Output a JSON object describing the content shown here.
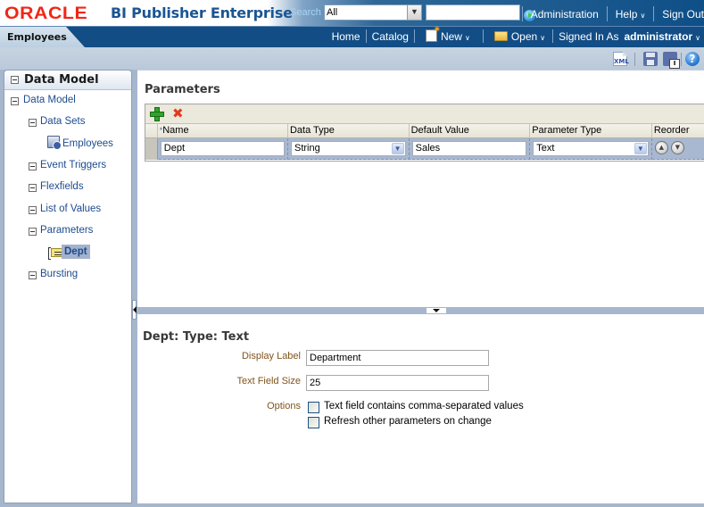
{
  "brand": {
    "logo": "ORACLE",
    "product": "BI Publisher Enterprise"
  },
  "search": {
    "label": "Search",
    "scope_value": "All",
    "query_value": "",
    "go_icon": "go-arrow-icon"
  },
  "global_links": {
    "administration": "Administration",
    "help": "Help",
    "sign_out": "Sign Out"
  },
  "nav": {
    "document_tab": "Employees",
    "home": "Home",
    "catalog": "Catalog",
    "new": "New",
    "open": "Open",
    "signed_in_as": "Signed In As",
    "user": "administrator"
  },
  "toolbar": {
    "xml_icon_text": "XML",
    "icons": [
      "xml-icon",
      "save-icon",
      "save-as-icon",
      "help-icon"
    ],
    "help_glyph": "?"
  },
  "left_panel": {
    "title": "Data Model",
    "tree": [
      {
        "label": "Data Model",
        "level": 0,
        "icon": "collapse-icon"
      },
      {
        "label": "Data Sets",
        "level": 1,
        "icon": "collapse-icon"
      },
      {
        "label": "Employees",
        "level": 2,
        "icon": "data-set-icon"
      },
      {
        "label": "Event Triggers",
        "level": 1,
        "icon": "collapse-icon"
      },
      {
        "label": "Flexfields",
        "level": 1,
        "icon": "collapse-icon"
      },
      {
        "label": "List of Values",
        "level": 1,
        "icon": "collapse-icon"
      },
      {
        "label": "Parameters",
        "level": 1,
        "icon": "collapse-icon"
      },
      {
        "label": "Dept",
        "level": 2,
        "icon": "parameter-icon",
        "selected": true
      },
      {
        "label": "Bursting",
        "level": 1,
        "icon": "collapse-icon"
      }
    ]
  },
  "parameters": {
    "title": "Parameters",
    "columns": [
      "Name",
      "Data Type",
      "Default Value",
      "Parameter Type",
      "Reorder"
    ],
    "required_marker": "*",
    "rows": [
      {
        "name": "Dept",
        "data_type": "String",
        "default_value": "Sales",
        "parameter_type": "Text"
      }
    ]
  },
  "properties": {
    "title": "Dept: Type: Text",
    "display_label_label": "Display Label",
    "display_label_value": "Department",
    "text_field_size_label": "Text Field Size",
    "text_field_size_value": "25",
    "options_label": "Options",
    "options": [
      {
        "label": "Text field contains comma-separated values",
        "checked": false
      },
      {
        "label": "Refresh other parameters on change",
        "checked": false
      }
    ]
  }
}
